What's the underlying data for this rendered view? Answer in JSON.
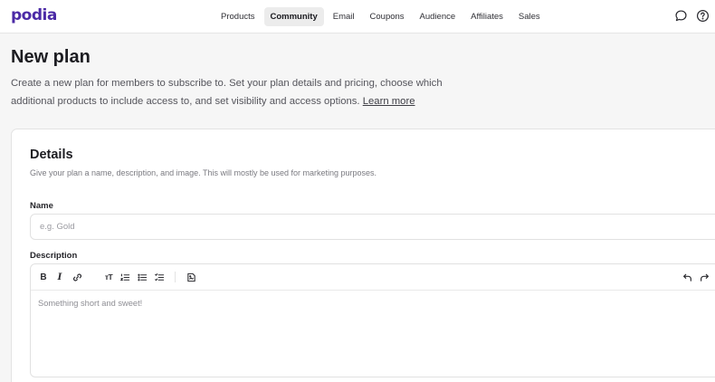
{
  "brand": {
    "logo_text": "podia",
    "color": "#4b2aa6"
  },
  "nav": {
    "items": [
      {
        "label": "Products",
        "active": false
      },
      {
        "label": "Community",
        "active": true
      },
      {
        "label": "Email",
        "active": false
      },
      {
        "label": "Coupons",
        "active": false
      },
      {
        "label": "Audience",
        "active": false
      },
      {
        "label": "Affiliates",
        "active": false
      },
      {
        "label": "Sales",
        "active": false
      }
    ],
    "icons": [
      "chat-icon",
      "help-icon"
    ]
  },
  "page": {
    "title": "New plan",
    "intro": "Create a new plan for members to subscribe to. Set your plan details and pricing, choose which additional products to include access to, and set visibility and access options.",
    "learn_more": "Learn more"
  },
  "details": {
    "title": "Details",
    "subtitle": "Give your plan a name, description, and image. This will mostly be used for marketing purposes.",
    "name_label": "Name",
    "name_value": "",
    "name_placeholder": "e.g. Gold",
    "description_label": "Description",
    "description_placeholder": "Something short and sweet!",
    "toolbar": {
      "bold": "B",
      "italic": "I",
      "text_size": "тT",
      "icons": [
        "bold-icon",
        "italic-icon",
        "link-icon",
        "text-size-icon",
        "ordered-list-icon",
        "bullet-list-icon",
        "checklist-icon",
        "image-icon",
        "undo-icon",
        "redo-icon"
      ]
    }
  }
}
